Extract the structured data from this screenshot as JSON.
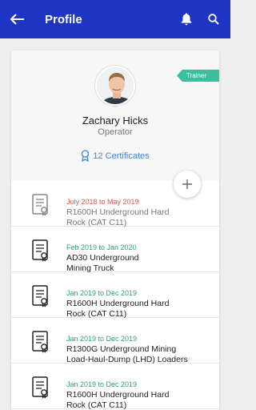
{
  "header": {
    "title": "Profile"
  },
  "profile": {
    "badge": "Trainer",
    "name": "Zachary Hicks",
    "role": "Operator",
    "certificates_link": "12 Certificates"
  },
  "colors": {
    "appbar": "#1e35c4",
    "badge": "#3bbf9d",
    "link": "#3b86d6",
    "date_expired": "#e05a4d",
    "date_valid": "#2f9e78"
  },
  "certificates": [
    {
      "date": "July 2018 to May 2019",
      "title_line1": "R1600H Underground Hard",
      "title_line2": "Rock (CAT C11)",
      "status": "expired"
    },
    {
      "date": "Feb 2019 to Jan 2020",
      "title_line1": "AD30 Underground",
      "title_line2": "Mining Truck",
      "status": "valid"
    },
    {
      "date": "Jan 2019 to Dec 2019",
      "title_line1": "R1600H Underground Hard",
      "title_line2": "Rock (CAT C11)",
      "status": "valid"
    },
    {
      "date": "Jan 2019 to Dec 2019",
      "title_line1": "R1300G Underground Mining",
      "title_line2": "Load-Haul-Dump (LHD) Loaders",
      "status": "valid"
    },
    {
      "date": "Jan 2019 to Dec 2019",
      "title_line1": "R1600H Underground Hard",
      "title_line2": "Rock (CAT C11)",
      "status": "valid"
    }
  ]
}
